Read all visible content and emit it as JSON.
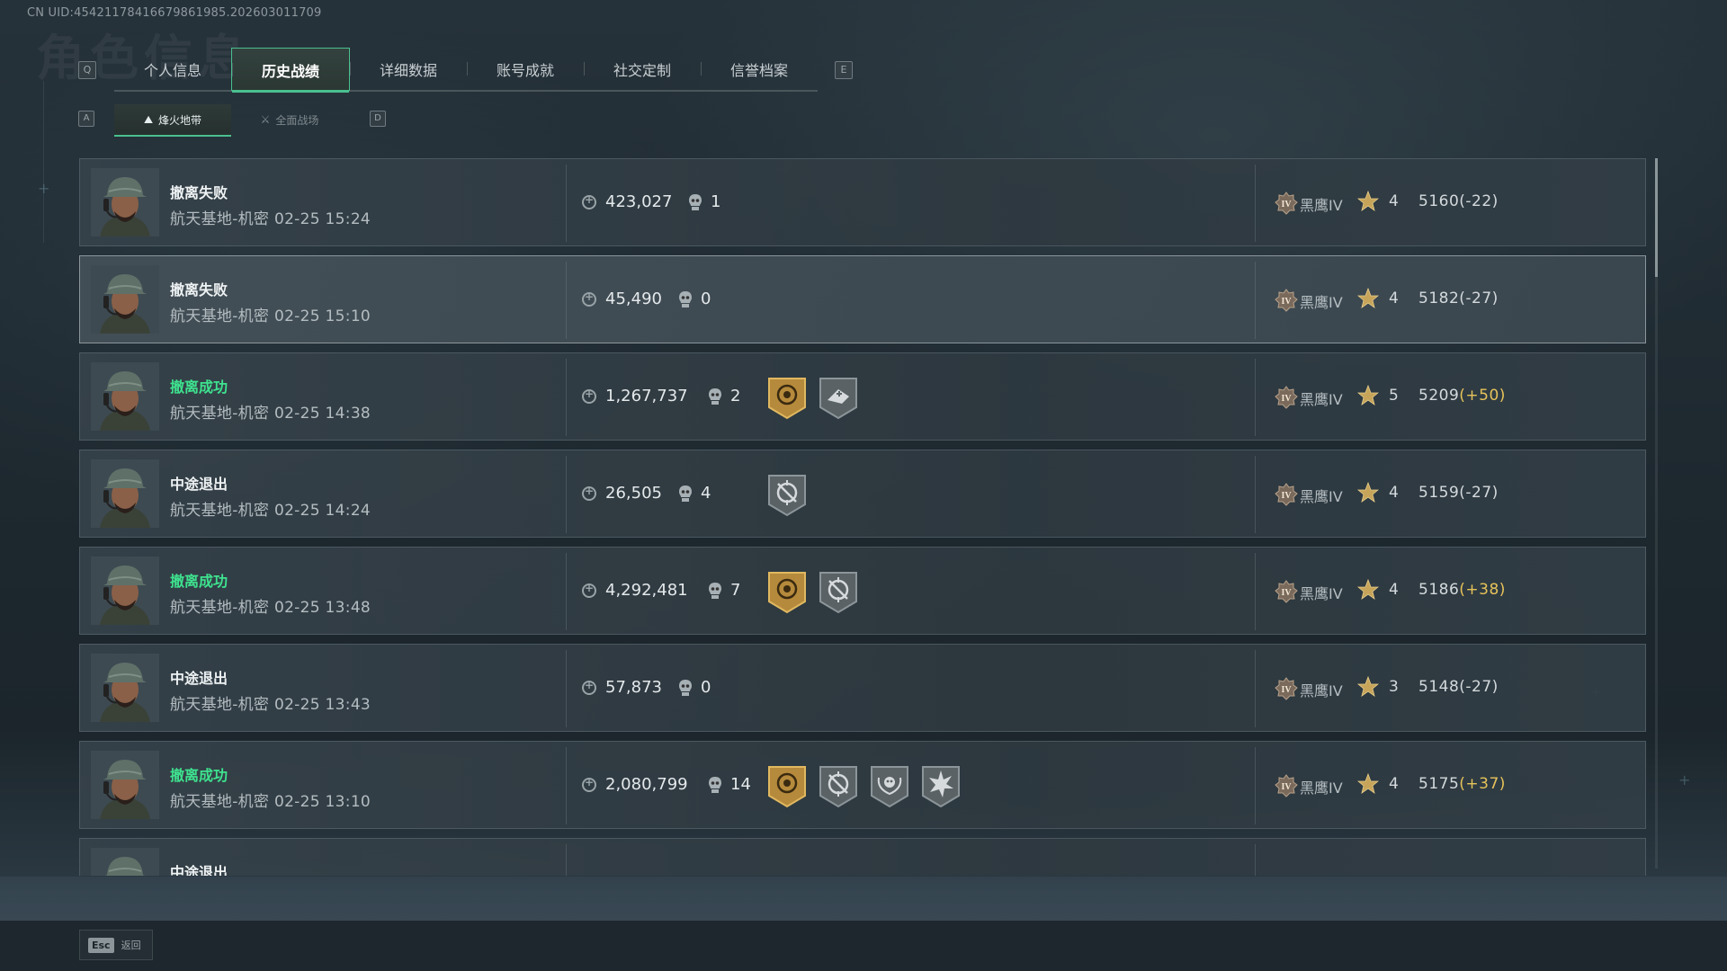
{
  "uid": "CN UID:4542117841667986198​5.202603011709",
  "tabs": {
    "left_key": "Q",
    "right_key": "E",
    "items": [
      "个人信息",
      "历史战绩",
      "详细数据",
      "账号成就",
      "社交定制",
      "信誉档案"
    ],
    "active_index": 1
  },
  "subtabs": {
    "left_key": "A",
    "right_key": "D",
    "items": [
      {
        "label": "烽火地带",
        "icon": "map-icon"
      },
      {
        "label": "全面战场",
        "icon": "battlefield-icon"
      }
    ],
    "active_index": 0
  },
  "rank_name": "黑鹰IV",
  "matches": [
    {
      "status": "撤离失败",
      "success": false,
      "map": "航天基地-机密",
      "time": "02-25 15:24",
      "money": "423,027",
      "kills": "1",
      "badges": [],
      "stars": "4",
      "score": "5160",
      "delta": "(-22)",
      "delta_positive": false
    },
    {
      "status": "撤离失败",
      "success": false,
      "map": "航天基地-机密",
      "time": "02-25 15:10",
      "money": "45,490",
      "kills": "0",
      "badges": [],
      "stars": "4",
      "score": "5182",
      "delta": "(-27)",
      "delta_positive": false
    },
    {
      "status": "撤离成功",
      "success": true,
      "map": "航天基地-机密",
      "time": "02-25 14:38",
      "money": "1,267,737",
      "kills": "2",
      "badges": [
        "gold-extract-badge",
        "medic-badge"
      ],
      "stars": "5",
      "score": "5209",
      "delta": "(+50)",
      "delta_positive": true
    },
    {
      "status": "中途退出",
      "success": false,
      "map": "航天基地-机密",
      "time": "02-25 14:24",
      "money": "26,505",
      "kills": "4",
      "badges": [
        "crosshair-badge"
      ],
      "stars": "4",
      "score": "5159",
      "delta": "(-27)",
      "delta_positive": false
    },
    {
      "status": "撤离成功",
      "success": true,
      "map": "航天基地-机密",
      "time": "02-25 13:48",
      "money": "4,292,481",
      "kills": "7",
      "badges": [
        "gold-extract-badge",
        "crosshair-badge"
      ],
      "stars": "4",
      "score": "5186",
      "delta": "(+38)",
      "delta_positive": true
    },
    {
      "status": "中途退出",
      "success": false,
      "map": "航天基地-机密",
      "time": "02-25 13:43",
      "money": "57,873",
      "kills": "0",
      "badges": [],
      "stars": "3",
      "score": "5148",
      "delta": "(-27)",
      "delta_positive": false
    },
    {
      "status": "撤离成功",
      "success": true,
      "map": "航天基地-机密",
      "time": "02-25 13:10",
      "money": "2,080,799",
      "kills": "14",
      "badges": [
        "gold-extract-badge",
        "crosshair-badge",
        "skull-wreath-badge",
        "explosion-badge"
      ],
      "stars": "4",
      "score": "5175",
      "delta": "(+37)",
      "delta_positive": true
    },
    {
      "status": "中途退出",
      "success": false,
      "map": "",
      "time": "",
      "money": "",
      "kills": "",
      "badges": [],
      "stars": "",
      "score": "",
      "delta": "",
      "delta_positive": false
    }
  ],
  "footer": {
    "esc_key": "Esc",
    "back_label": "返回"
  },
  "colors": {
    "accent": "#49c08f",
    "success": "#3ee28f",
    "positive_delta": "#e6c35a"
  }
}
